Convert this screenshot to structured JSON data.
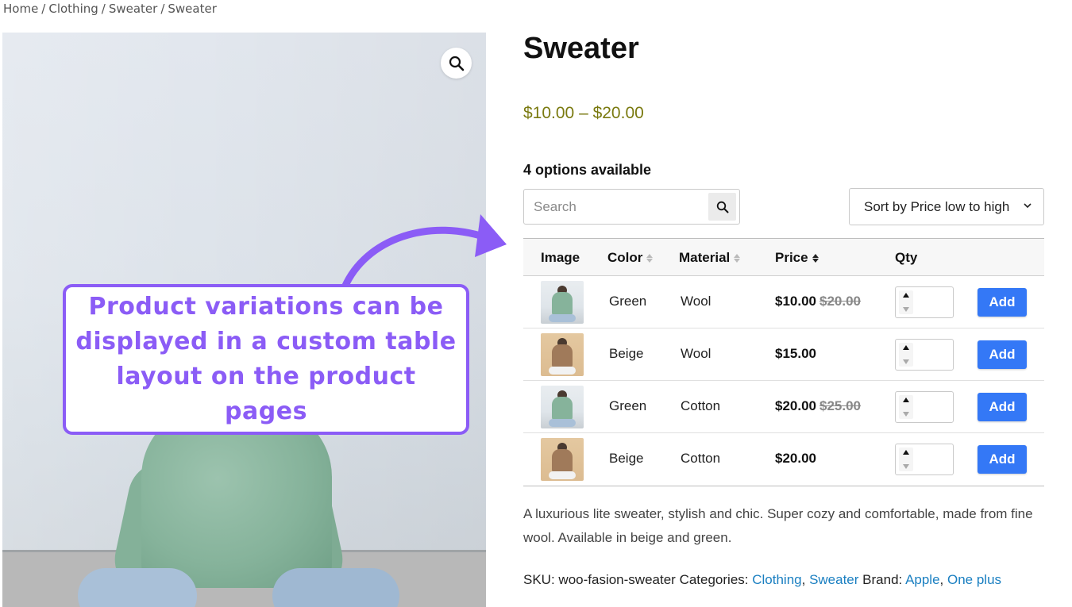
{
  "breadcrumb": {
    "items": [
      "Home",
      "Clothing",
      "Sweater",
      "Sweater"
    ],
    "separator": "/"
  },
  "product": {
    "title": "Sweater",
    "price_range": "$10.00 – $20.00",
    "options_label": "4 options available",
    "zoom_icon": "search-zoom-icon"
  },
  "callout": {
    "text": "Product variations can be displayed in a custom table layout on the product pages",
    "accent_color": "#8b5cf6"
  },
  "controls": {
    "search_placeholder": "Search",
    "sort_label": "Sort by Price low to high"
  },
  "table": {
    "headers": {
      "image": "Image",
      "color": "Color",
      "material": "Material",
      "price": "Price",
      "qty": "Qty"
    },
    "rows": [
      {
        "thumb": "green",
        "color": "Green",
        "material": "Wool",
        "price": "$10.00",
        "old_price": "$20.00",
        "qty": "",
        "button": "Add"
      },
      {
        "thumb": "beige",
        "color": "Beige",
        "material": "Wool",
        "price": "$15.00",
        "old_price": "",
        "qty": "",
        "button": "Add"
      },
      {
        "thumb": "green",
        "color": "Green",
        "material": "Cotton",
        "price": "$20.00",
        "old_price": "$25.00",
        "qty": "",
        "button": "Add"
      },
      {
        "thumb": "beige",
        "color": "Beige",
        "material": "Cotton",
        "price": "$20.00",
        "old_price": "",
        "qty": "",
        "button": "Add"
      }
    ],
    "button_color": "#3478f6"
  },
  "description": "A luxurious lite sweater, stylish and chic. Super cozy and comfortable, made from fine wool. Available in beige and green.",
  "meta": {
    "sku_label": "SKU:",
    "sku_value": "woo-fasion-sweater",
    "categories_label": "Categories:",
    "categories": [
      "Clothing",
      "Sweater"
    ],
    "brand_label": "Brand:",
    "brands": [
      "Apple",
      "One plus"
    ],
    "link_color": "#1a7fc1"
  }
}
